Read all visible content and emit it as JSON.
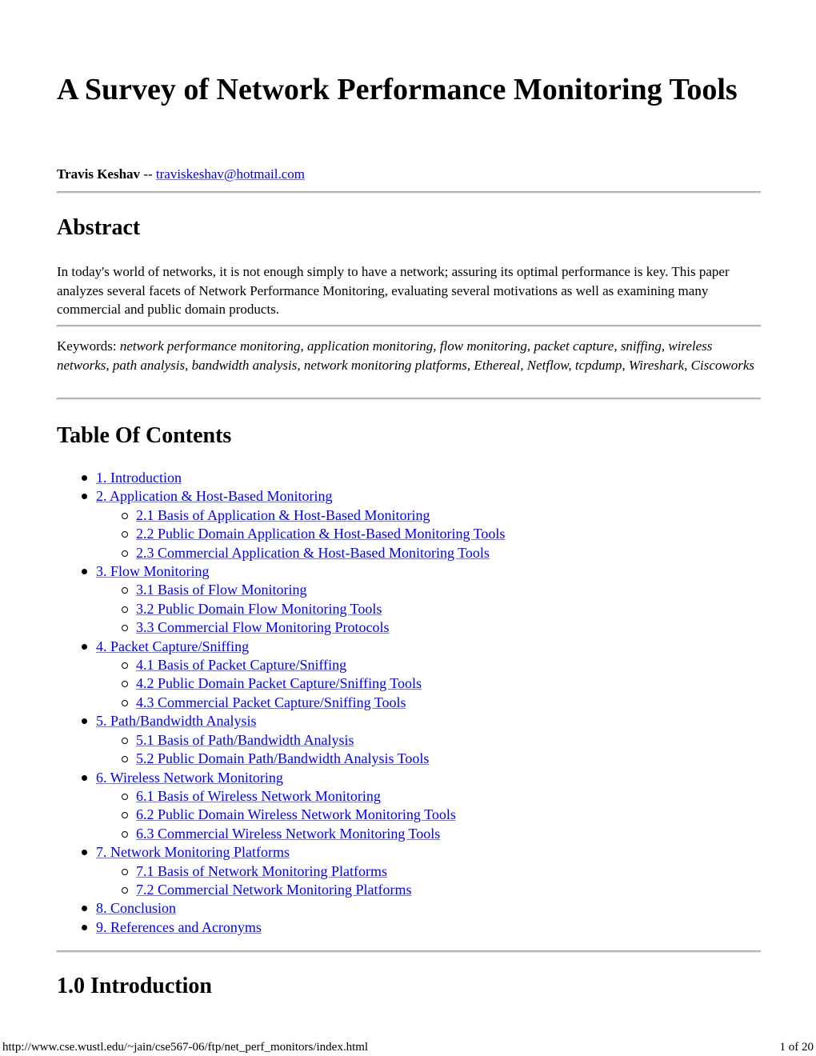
{
  "document": {
    "title": "A Survey of Network Performance Monitoring Tools",
    "author": {
      "name": "Travis Keshav",
      "separator": " -- ",
      "email": "traviskeshav@hotmail.com"
    },
    "abstract": {
      "heading": "Abstract",
      "text": "In today's world of networks, it is not enough simply to have a network; assuring its optimal performance is key. This paper analyzes several facets of Network Performance Monitoring, evaluating several motivations as well as examining many commercial and public domain products."
    },
    "keywords": {
      "label": "Keywords: ",
      "text": "network performance monitoring, application monitoring, flow monitoring, packet capture, sniffing, wireless networks, path analysis, bandwidth analysis, network monitoring platforms, Ethereal, Netflow, tcpdump, Wireshark, Ciscoworks"
    },
    "toc": {
      "heading": "Table Of Contents",
      "items": [
        {
          "level": 1,
          "label": "1. Introduction"
        },
        {
          "level": 1,
          "label": "2. Application & Host-Based Monitoring"
        },
        {
          "level": 2,
          "label": "2.1 Basis of Application & Host-Based Monitoring"
        },
        {
          "level": 2,
          "label": "2.2 Public Domain Application & Host-Based Monitoring Tools"
        },
        {
          "level": 2,
          "label": "2.3 Commercial Application & Host-Based Monitoring Tools"
        },
        {
          "level": 1,
          "label": "3. Flow Monitoring"
        },
        {
          "level": 2,
          "label": "3.1 Basis of Flow Monitoring"
        },
        {
          "level": 2,
          "label": "3.2 Public Domain Flow Monitoring Tools"
        },
        {
          "level": 2,
          "label": "3.3 Commercial Flow Monitoring Protocols"
        },
        {
          "level": 1,
          "label": "4. Packet Capture/Sniffing"
        },
        {
          "level": 2,
          "label": "4.1 Basis of Packet Capture/Sniffing"
        },
        {
          "level": 2,
          "label": "4.2 Public Domain Packet Capture/Sniffing Tools"
        },
        {
          "level": 2,
          "label": "4.3 Commercial Packet Capture/Sniffing Tools"
        },
        {
          "level": 1,
          "label": "5. Path/Bandwidth Analysis"
        },
        {
          "level": 2,
          "label": "5.1 Basis of Path/Bandwidth Analysis"
        },
        {
          "level": 2,
          "label": "5.2 Public Domain Path/Bandwidth Analysis Tools"
        },
        {
          "level": 1,
          "label": "6. Wireless Network Monitoring"
        },
        {
          "level": 2,
          "label": "6.1 Basis of Wireless Network Monitoring"
        },
        {
          "level": 2,
          "label": "6.2 Public Domain Wireless Network Monitoring Tools"
        },
        {
          "level": 2,
          "label": "6.3 Commercial Wireless Network Monitoring Tools"
        },
        {
          "level": 1,
          "label": "7. Network Monitoring Platforms"
        },
        {
          "level": 2,
          "label": "7.1 Basis of Network Monitoring Platforms"
        },
        {
          "level": 2,
          "label": "7.2 Commercial Network Monitoring Platforms"
        },
        {
          "level": 1,
          "label": "8. Conclusion"
        },
        {
          "level": 1,
          "label": "9. References and Acronyms"
        }
      ]
    },
    "next_section_heading": "1.0 Introduction"
  },
  "footer": {
    "url": "http://www.cse.wustl.edu/~jain/cse567-06/ftp/net_perf_monitors/index.html",
    "page_indicator": "1 of 20"
  },
  "colors": {
    "link": "#0000ee",
    "rule": "#c0c0c0",
    "text": "#000000"
  }
}
